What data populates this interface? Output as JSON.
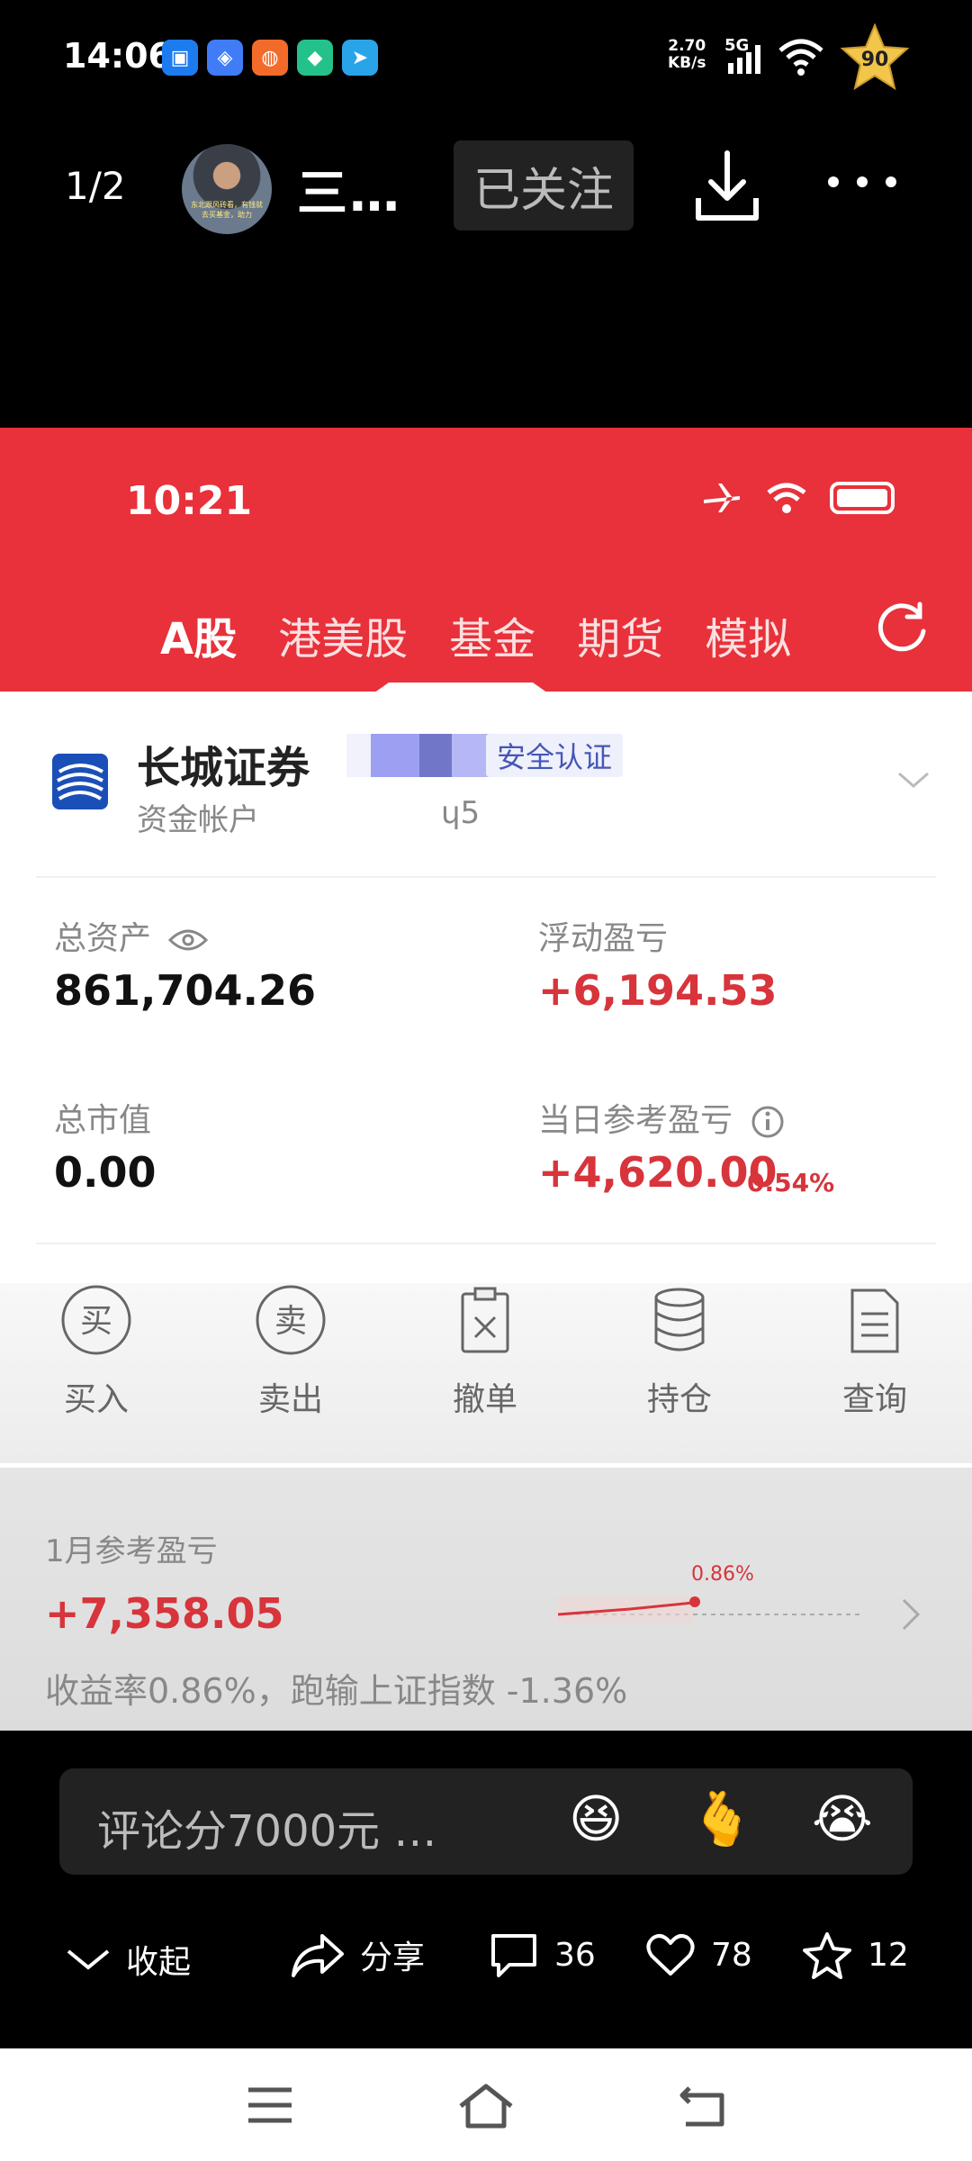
{
  "status_bar": {
    "time": "14:06",
    "net_speed_value": "2.70",
    "net_speed_unit": "KB/s",
    "network": "5G",
    "battery_badge": "90",
    "app_icons": [
      "app-icon-blue",
      "app-icon-blue2",
      "app-icon-orange",
      "app-icon-green",
      "app-icon-telegram"
    ]
  },
  "viewer": {
    "page_indicator": "1/2",
    "username": "三…",
    "follow_label": "已关注",
    "avatar_caption": "东北跟风砖看，有钱就去买基金，助力"
  },
  "screenshot": {
    "time": "10:21",
    "tabs": [
      {
        "label": "A股",
        "active": true
      },
      {
        "label": "港美股",
        "active": false
      },
      {
        "label": "基金",
        "active": false
      },
      {
        "label": "期货",
        "active": false
      },
      {
        "label": "模拟",
        "active": false
      }
    ],
    "broker_name": "长城证券",
    "security_badge": "安全认证",
    "account_label": "资金帐户",
    "account_tail": "ɥ5",
    "total_assets_label": "总资产",
    "total_assets_value": "861,704.26",
    "floating_pl_label": "浮动盈亏",
    "floating_pl_value": "+6,194.53",
    "market_value_label": "总市值",
    "market_value_value": "0.00",
    "daily_pl_label": "当日参考盈亏",
    "daily_pl_value": "+4,620.00",
    "daily_pl_pct": "0.54%",
    "actions": [
      {
        "label": "买入",
        "icon_char": "买"
      },
      {
        "label": "卖出",
        "icon_char": "卖"
      },
      {
        "label": "撤单",
        "icon": "cancel-order-icon"
      },
      {
        "label": "持仓",
        "icon": "holdings-icon"
      },
      {
        "label": "查询",
        "icon": "query-icon"
      }
    ],
    "month_label": "1月参考盈亏",
    "month_value": "+7,358.05",
    "month_desc": "收益率0.86%，跑输上证指数 -1.36%",
    "month_chart_label": "0.86%"
  },
  "comment": {
    "placeholder": "评论分7000元 …",
    "emojis": [
      "😆",
      "🫰",
      "😭"
    ]
  },
  "bottom_actions": {
    "collapse": "收起",
    "share": "分享",
    "comments": "36",
    "likes": "78",
    "favorites": "12"
  },
  "colors": {
    "brand_red": "#e8313a",
    "profit_red": "#d7343b",
    "broker_blue": "#1b4fb8"
  }
}
